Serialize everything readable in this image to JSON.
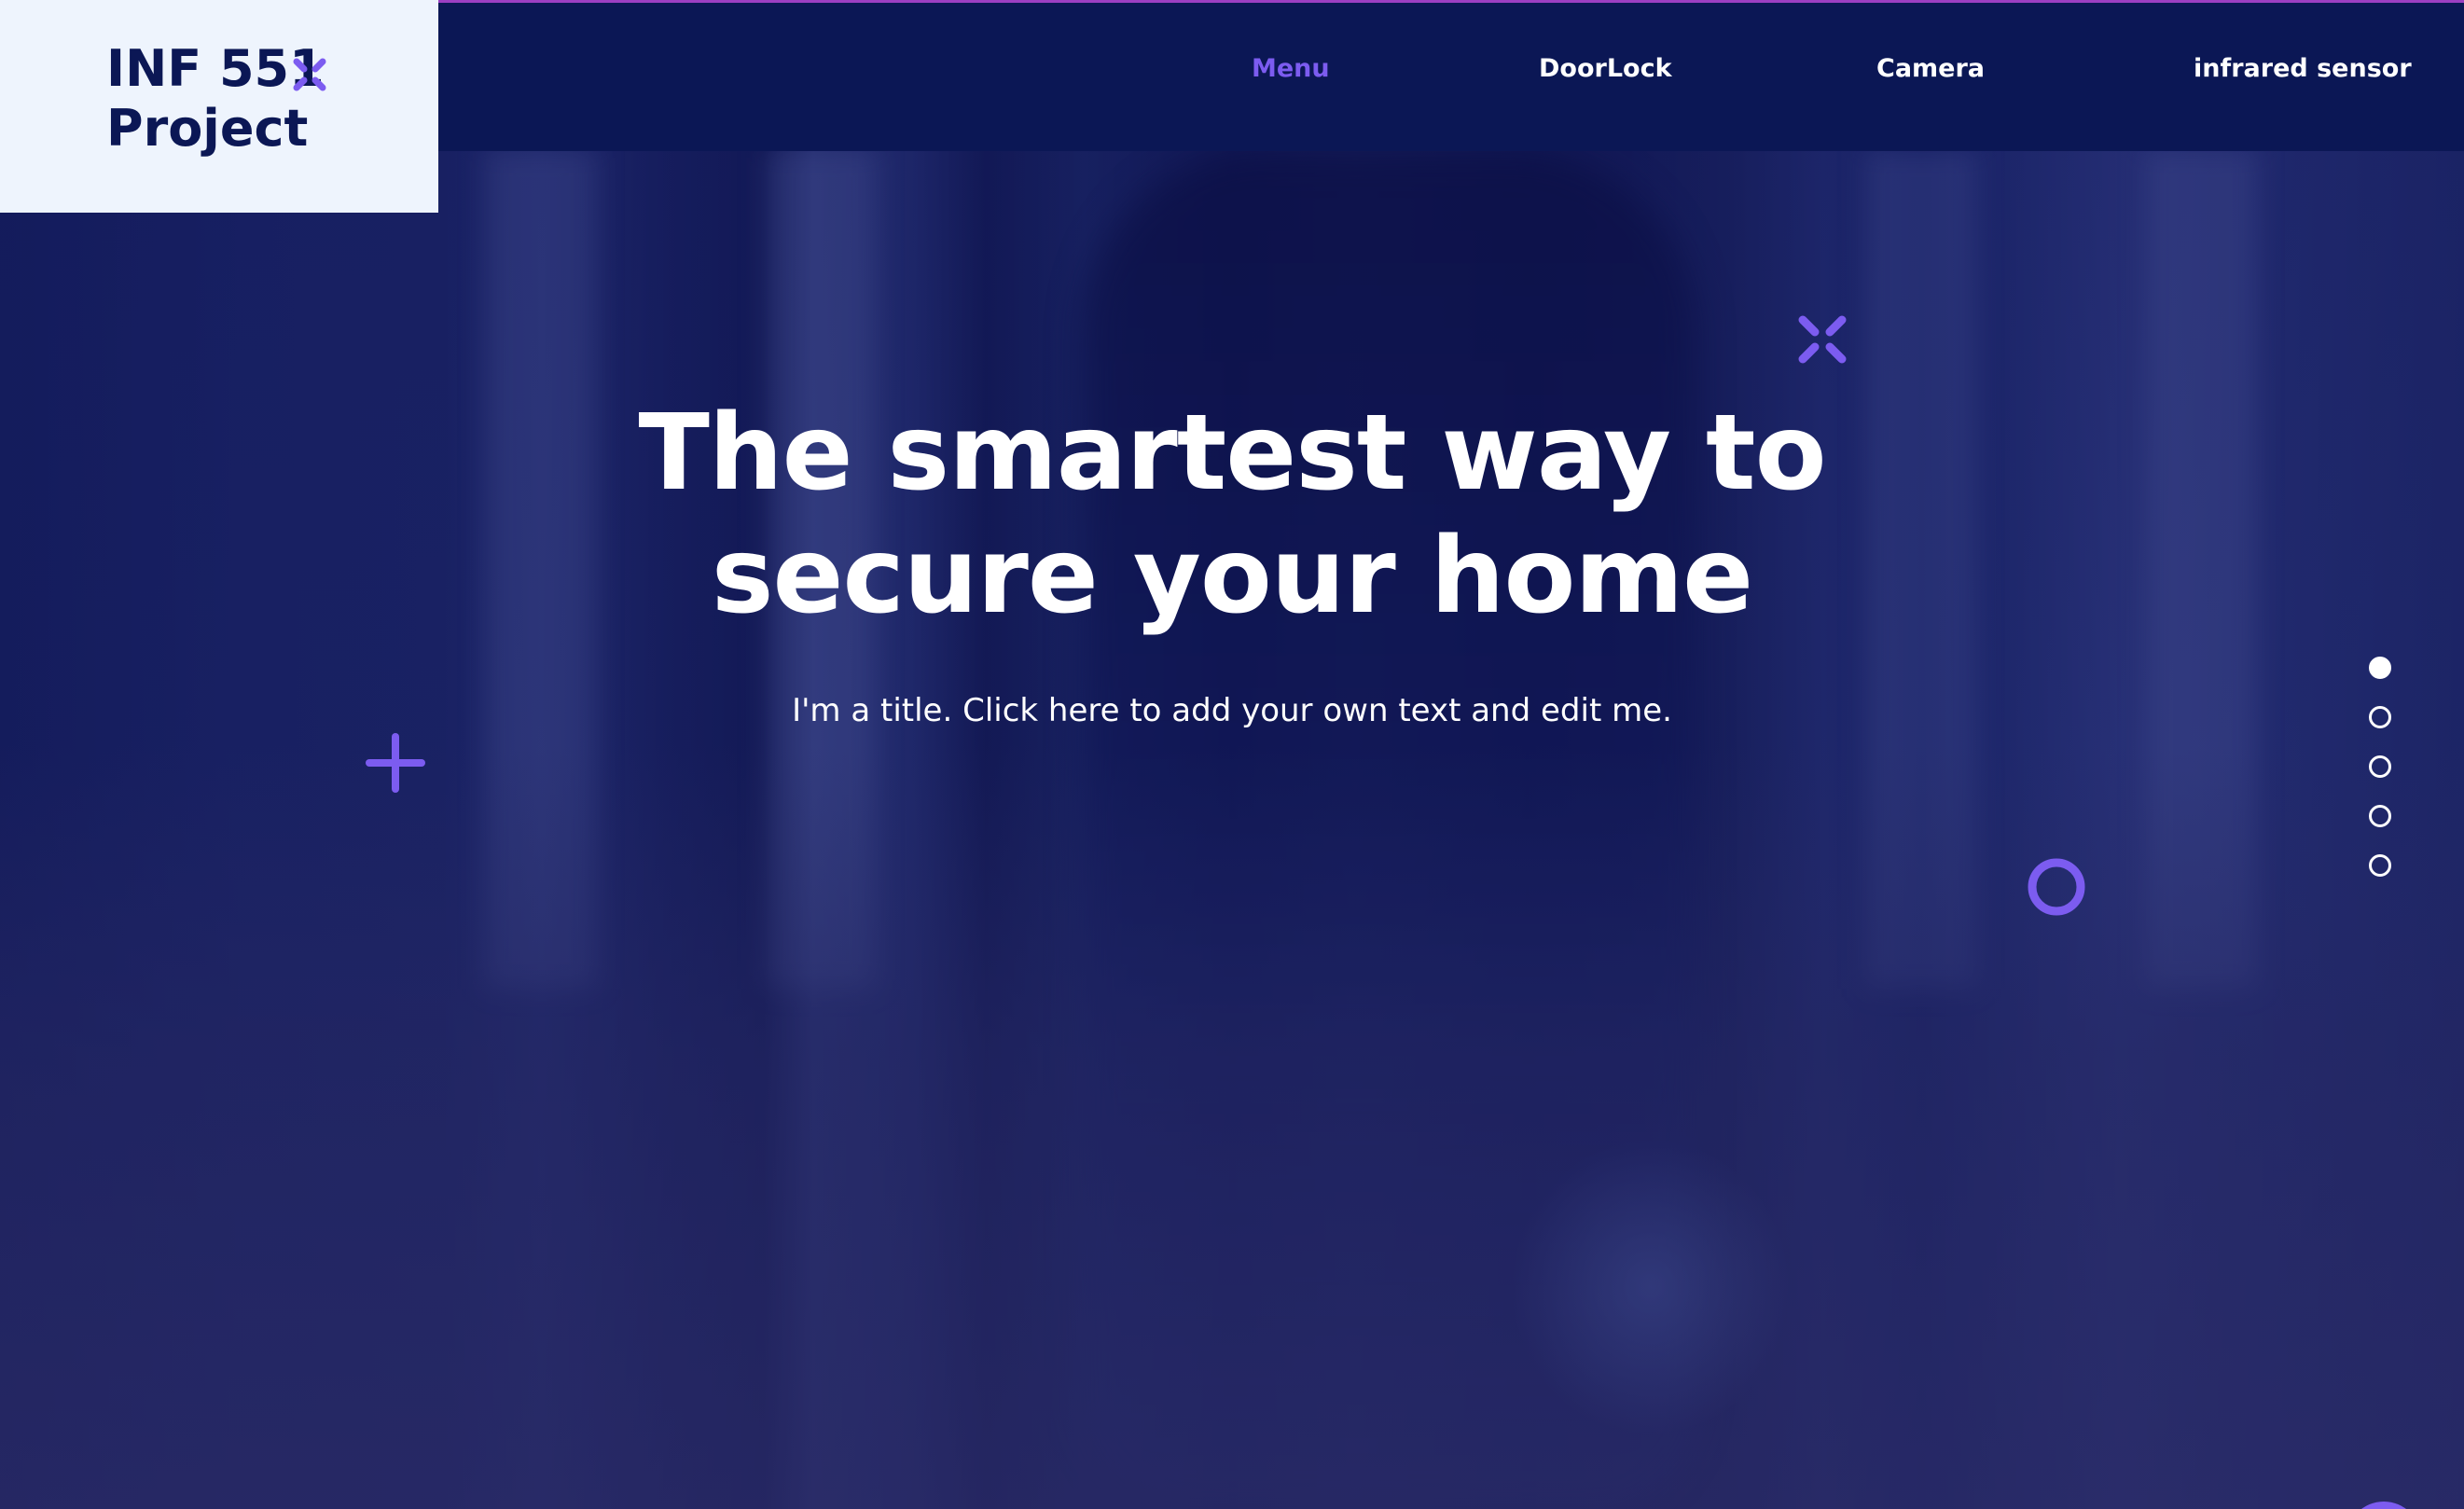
{
  "logo": {
    "line1": "INF 551",
    "line2": "Project"
  },
  "nav": {
    "items": [
      {
        "label": "Menu",
        "active": true
      },
      {
        "label": "DoorLock",
        "active": false
      },
      {
        "label": "Camera",
        "active": false
      },
      {
        "label": "infrared sensor",
        "active": false
      }
    ]
  },
  "hero": {
    "title_line1": "The smartest way to",
    "title_line2": "secure your home",
    "subtitle": "I'm a title. Click here to add your own text and edit me."
  },
  "slide_dots": {
    "count": 5,
    "active_index": 0
  },
  "colors": {
    "accent": "#7c5cf0",
    "header_bg": "#0b1755",
    "logo_bg": "#eef4fd",
    "text": "#ffffff"
  },
  "icons": {
    "logo_mark": "x-mark-icon",
    "deco_top": "x-mark-icon",
    "deco_left": "plus-icon",
    "deco_right": "ring-icon"
  }
}
